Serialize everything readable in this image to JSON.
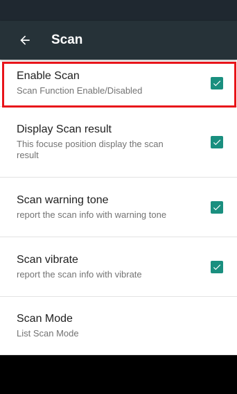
{
  "app_bar": {
    "title": "Scan",
    "back_icon": "arrow-left-icon"
  },
  "colors": {
    "app_bar": "#263238",
    "accent": "#1a8f7f",
    "highlight": "#e8141a"
  },
  "settings": [
    {
      "title": "Enable Scan",
      "summary": "Scan Function Enable/Disabled",
      "checked": true
    },
    {
      "title": "Display Scan result",
      "summary": "This focuse position display the scan result",
      "checked": true
    },
    {
      "title": "Scan warning tone",
      "summary": "report the scan info with warning tone",
      "checked": true
    },
    {
      "title": "Scan vibrate",
      "summary": "report the scan info with vibrate",
      "checked": true
    },
    {
      "title": "Scan Mode",
      "summary": "List Scan Mode"
    }
  ]
}
